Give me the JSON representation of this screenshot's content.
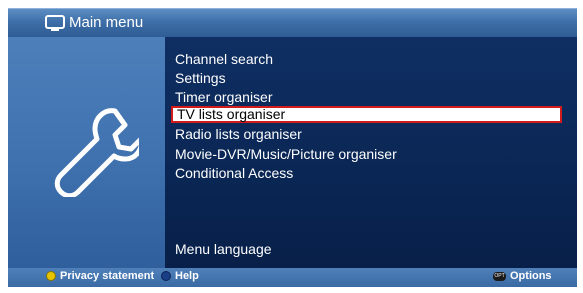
{
  "header": {
    "title": "Main menu",
    "icon": "tv-icon"
  },
  "sidebar": {
    "icon": "wrench-icon"
  },
  "menu": {
    "items": [
      {
        "label": "Channel search"
      },
      {
        "label": "Settings"
      },
      {
        "label": "Timer organiser"
      },
      {
        "label": "TV lists organiser"
      },
      {
        "label": "Radio lists organiser"
      },
      {
        "label": "Movie-DVR/Music/Picture organiser"
      },
      {
        "label": "Conditional Access"
      }
    ],
    "selected_index": 3,
    "language_item": "Menu language"
  },
  "footer": {
    "privacy_label": "Privacy statement",
    "help_label": "Help",
    "options_label": "Options",
    "options_badge": "OPT"
  },
  "colors": {
    "highlight_border": "#d21c1c",
    "panel_dark": "#0a2654",
    "panel_light": "#3e71ae"
  }
}
